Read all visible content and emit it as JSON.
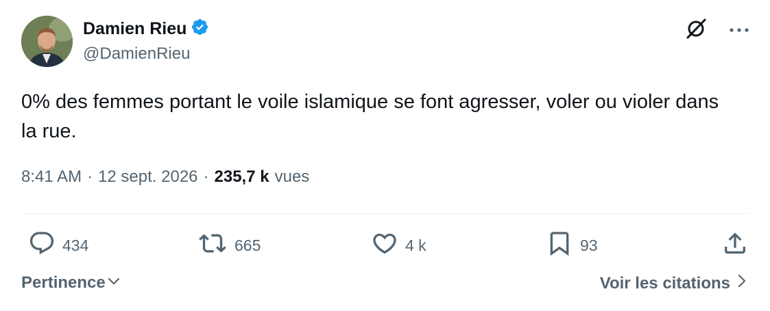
{
  "author": {
    "display_name": "Damien Rieu",
    "handle": "@DamienRieu",
    "verified": true,
    "verified_color": "#1d9bf0"
  },
  "tweet": {
    "text": "0% des femmes portant le voile islamique se font agresser, voler ou violer dans la rue."
  },
  "meta": {
    "time": "8:41 AM",
    "separator": "·",
    "date": "12 sept. 2026",
    "views_count": "235,7 k",
    "views_label": "vues"
  },
  "actions": {
    "replies": "434",
    "retweets": "665",
    "likes": "4 k",
    "bookmarks": "93"
  },
  "footer": {
    "sort_label": "Pertinence",
    "quotes_label": "Voir les citations"
  },
  "icons": {
    "grok": "grok-icon",
    "more": "more-icon",
    "reply": "reply-icon",
    "retweet": "retweet-icon",
    "like": "heart-icon",
    "bookmark": "bookmark-icon",
    "share": "share-icon"
  },
  "colors": {
    "text": "#0f1419",
    "secondary": "#536471",
    "divider": "#eff3f4"
  }
}
